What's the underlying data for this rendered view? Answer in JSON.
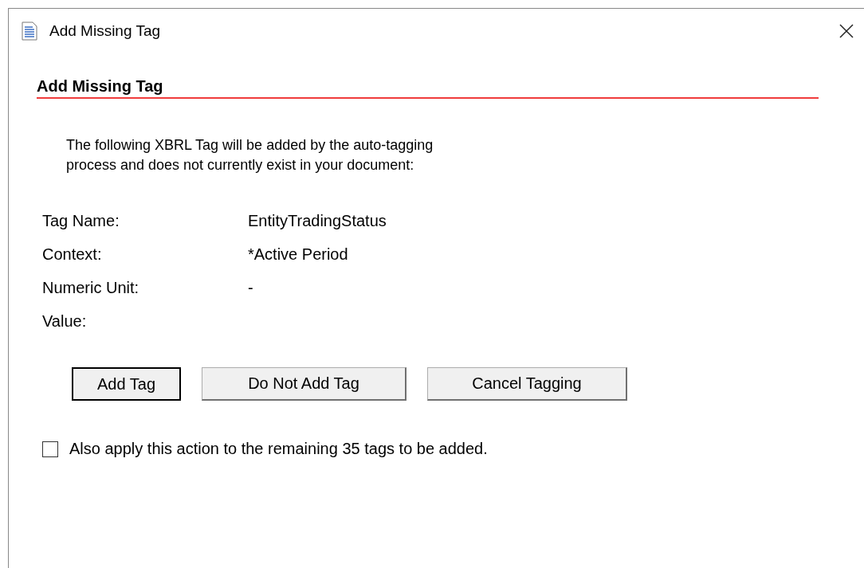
{
  "window": {
    "title": "Add Missing Tag"
  },
  "heading": "Add Missing Tag",
  "description": [
    "The following XBRL Tag will be added by the auto-tagging",
    "process and does not currently exist in your document:"
  ],
  "fields": [
    {
      "label": "Tag Name:",
      "value": "EntityTradingStatus"
    },
    {
      "label": "Context:",
      "value": "*Active Period"
    },
    {
      "label": "Numeric Unit:",
      "value": "-"
    },
    {
      "label": "Value:"
    }
  ],
  "buttons": [
    {
      "label": "Add Tag",
      "default": true
    },
    {
      "label": "Do Not Add Tag",
      "default": false
    },
    {
      "label": "Cancel Tagging",
      "default": false
    }
  ],
  "apply_all": {
    "label": "Also apply this action to the remaining 35 tags to be added.",
    "checked": false
  }
}
